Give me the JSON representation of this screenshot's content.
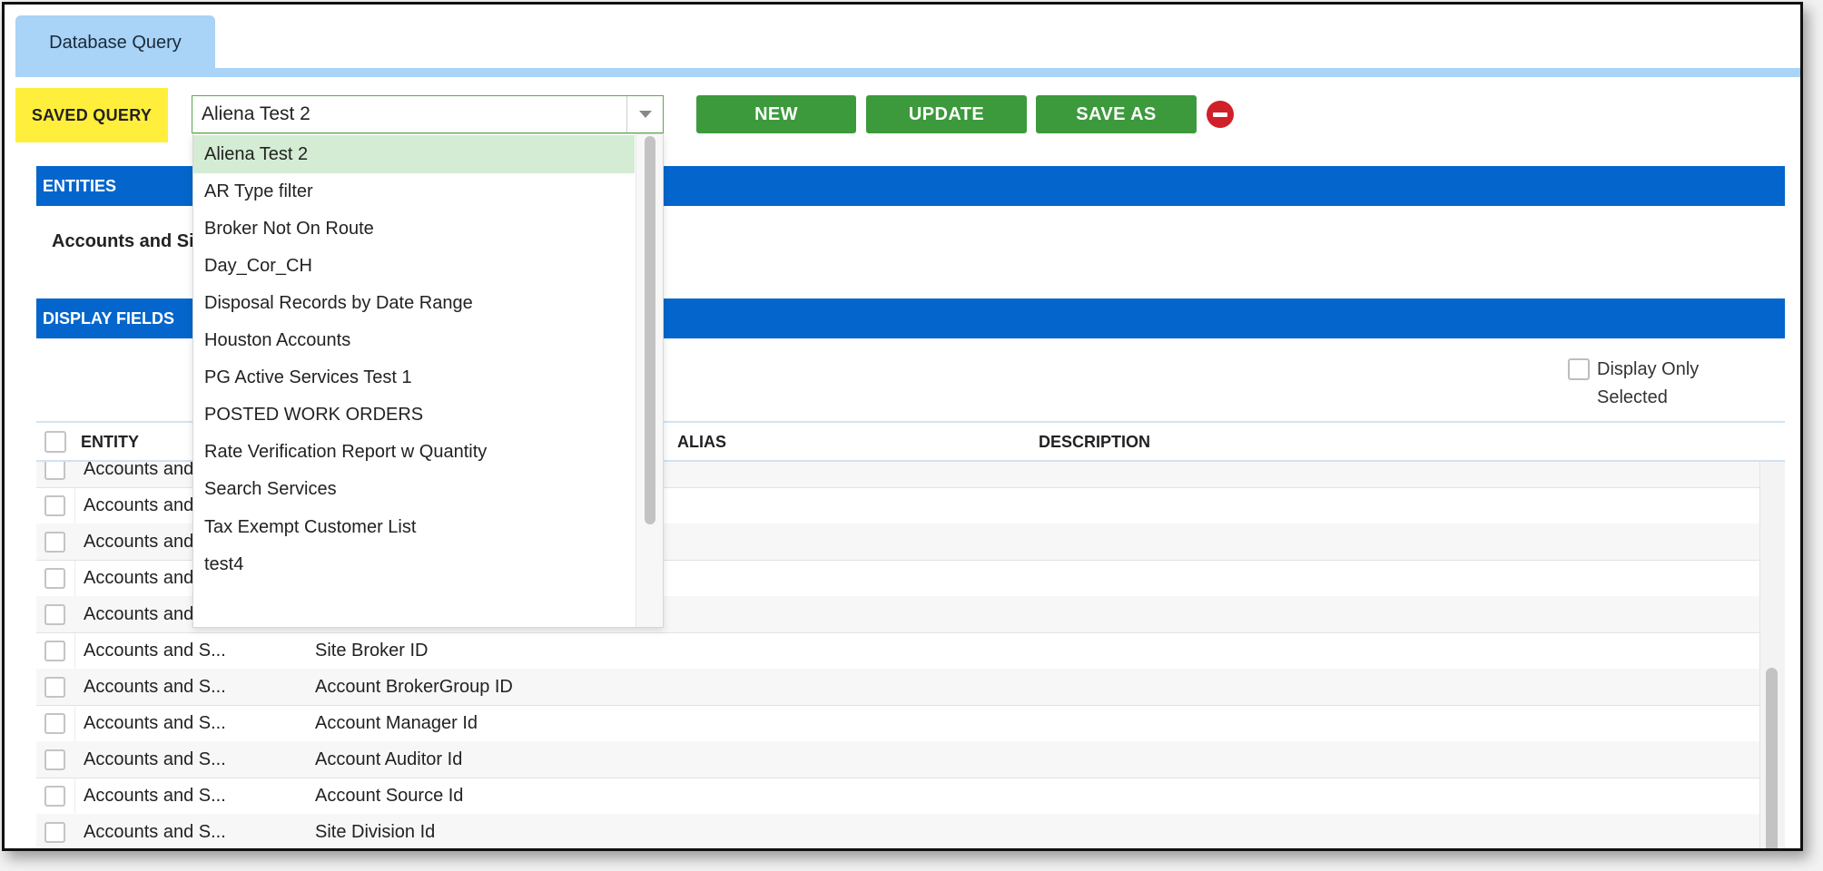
{
  "tab": {
    "label": "Database Query"
  },
  "saved_query": {
    "label": "SAVED QUERY",
    "selected": "Aliena Test 2",
    "options": [
      "Aliena Test 2",
      "AR Type filter",
      "Broker Not On Route",
      "Day_Cor_CH",
      "Disposal Records by Date Range",
      "Houston Accounts",
      "PG Active Services Test 1",
      "POSTED WORK ORDERS",
      "Rate Verification Report w Quantity",
      "Search Services",
      "Tax Exempt Customer List",
      "test4"
    ]
  },
  "toolbar": {
    "new_label": "NEW",
    "update_label": "UPDATE",
    "save_as_label": "SAVE AS"
  },
  "entities": {
    "header": "ENTITIES",
    "selected_entity": "Accounts and Sit"
  },
  "display_fields": {
    "header": "DISPLAY FIELDS",
    "display_only_selected_label": "Display Only Selected",
    "columns": {
      "entity": "ENTITY",
      "alias": "ALIAS",
      "description": "DESCRIPTION"
    },
    "rows": [
      {
        "entity": "Accounts and",
        "field": ""
      },
      {
        "entity": "Accounts and",
        "field": ""
      },
      {
        "entity": "Accounts and",
        "field": ""
      },
      {
        "entity": "Accounts and",
        "field": ""
      },
      {
        "entity": "Accounts and",
        "field": ""
      },
      {
        "entity": "Accounts and S...",
        "field": "Site Broker ID"
      },
      {
        "entity": "Accounts and S...",
        "field": "Account BrokerGroup ID"
      },
      {
        "entity": "Accounts and S...",
        "field": "Account Manager Id"
      },
      {
        "entity": "Accounts and S...",
        "field": "Account Auditor Id"
      },
      {
        "entity": "Accounts and S...",
        "field": "Account Source Id"
      },
      {
        "entity": "Accounts and S...",
        "field": "Site Division Id"
      }
    ]
  },
  "colors": {
    "accent_blue": "#0466cc",
    "tab_blue": "#a9d3f7",
    "button_green": "#3c9a3c",
    "label_yellow": "#ffef3c",
    "delete_red": "#d0202a",
    "selected_option": "#d3ecd3"
  },
  "icons": {
    "dropdown_arrow": "chevron-down-icon",
    "delete": "remove-circle-icon"
  }
}
